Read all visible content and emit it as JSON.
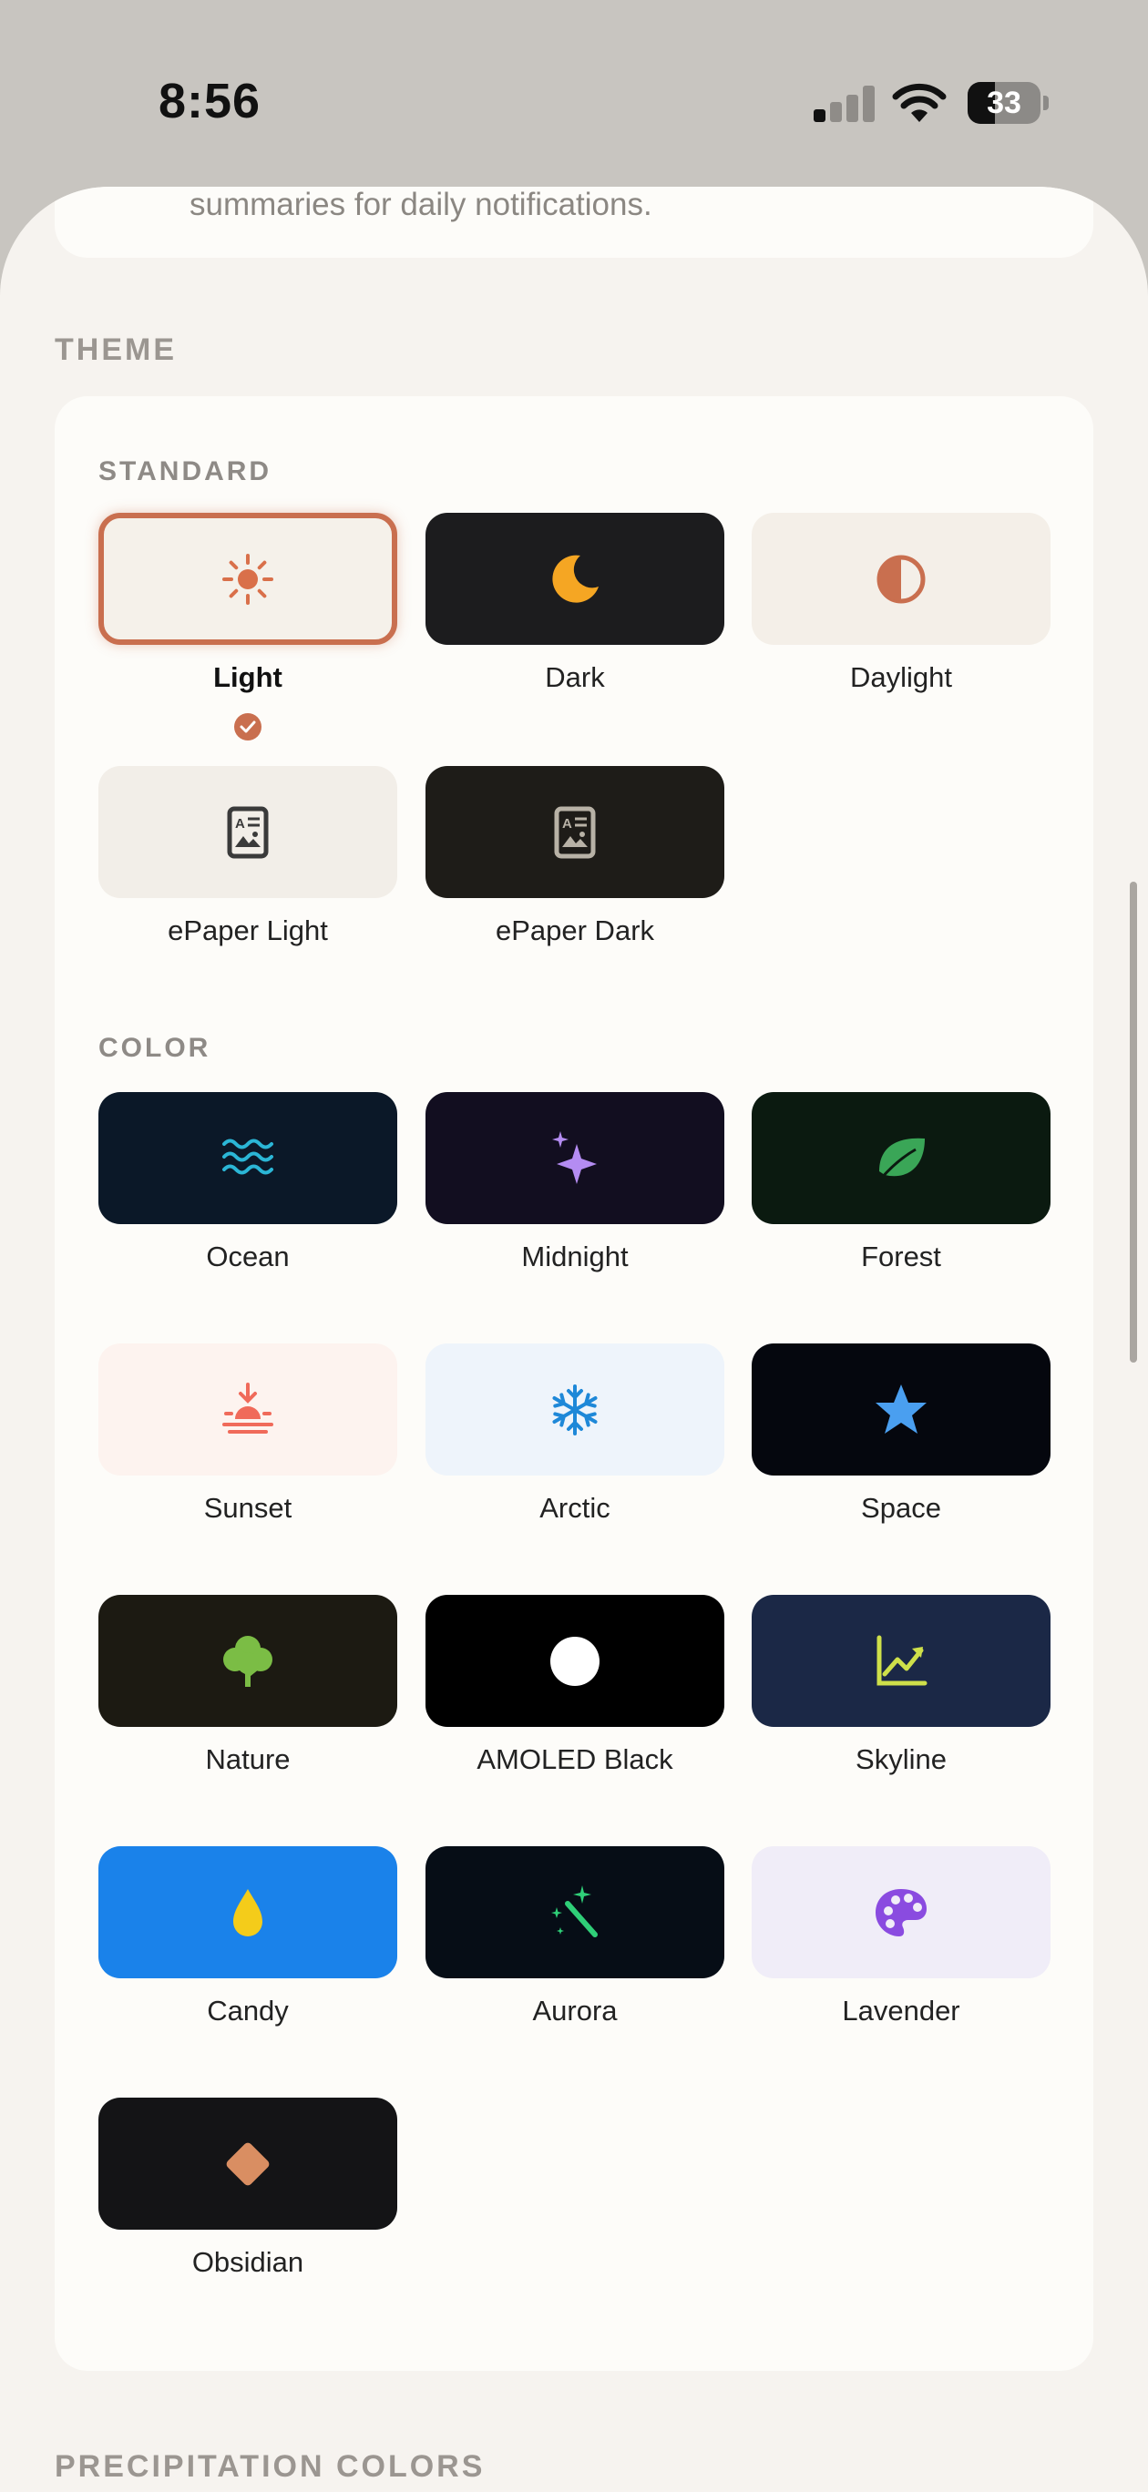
{
  "status": {
    "time": "8:56",
    "battery": "33"
  },
  "previous": {
    "text": "summaries for daily notifications."
  },
  "theme": {
    "label": "THEME",
    "standard_label": "STANDARD",
    "color_label": "COLOR",
    "standard": [
      {
        "label": "Light",
        "bg": "#f5f1ea",
        "fg": "#d9704a",
        "icon": "sun-icon",
        "selected": true
      },
      {
        "label": "Dark",
        "bg": "#1c1c1e",
        "fg": "#f5a623",
        "icon": "moon-icon"
      },
      {
        "label": "Daylight",
        "bg": "#f4efe8",
        "fg": "#c96f4f",
        "icon": "half-circle-icon"
      },
      {
        "label": "ePaper Light",
        "bg": "#f2eee8",
        "fg": "#3a3a3a",
        "icon": "newspaper-icon"
      },
      {
        "label": "ePaper Dark",
        "bg": "#1e1c18",
        "fg": "#b8b2a6",
        "icon": "newspaper-icon"
      }
    ],
    "color": [
      {
        "label": "Ocean",
        "bg": "#0b1828",
        "fg": "#2bb6d6",
        "icon": "waves-icon"
      },
      {
        "label": "Midnight",
        "bg": "#120e20",
        "fg": "#b48cf2",
        "icon": "sparkles-icon"
      },
      {
        "label": "Forest",
        "bg": "#0b1a10",
        "fg": "#3aa657",
        "icon": "leaf-icon"
      },
      {
        "label": "Sunset",
        "bg": "#fdf3ef",
        "fg": "#f06a5a",
        "icon": "sunset-icon"
      },
      {
        "label": "Arctic",
        "bg": "#eef4fb",
        "fg": "#1e88d8",
        "icon": "snowflake-icon"
      },
      {
        "label": "Space",
        "bg": "#05070e",
        "fg": "#4a9ff0",
        "icon": "star-icon"
      },
      {
        "label": "Nature",
        "bg": "#1c1a12",
        "fg": "#7bbd45",
        "icon": "tree-icon"
      },
      {
        "label": "AMOLED Black",
        "bg": "#000000",
        "fg": "#ffffff",
        "icon": "circle-icon"
      },
      {
        "label": "Skyline",
        "bg": "#1b2846",
        "fg": "#cfe04a",
        "icon": "chart-up-icon"
      },
      {
        "label": "Candy",
        "bg": "#1a82ea",
        "fg": "#f4cc1a",
        "icon": "drop-icon"
      },
      {
        "label": "Aurora",
        "bg": "#060d16",
        "fg": "#2fcf78",
        "icon": "wand-icon"
      },
      {
        "label": "Lavender",
        "bg": "#f0edf8",
        "fg": "#8a4be0",
        "icon": "palette-icon"
      },
      {
        "label": "Obsidian",
        "bg": "#141416",
        "fg": "#d98e62",
        "icon": "diamond-icon"
      }
    ]
  },
  "next_section": {
    "label": "PRECIPITATION COLORS"
  }
}
